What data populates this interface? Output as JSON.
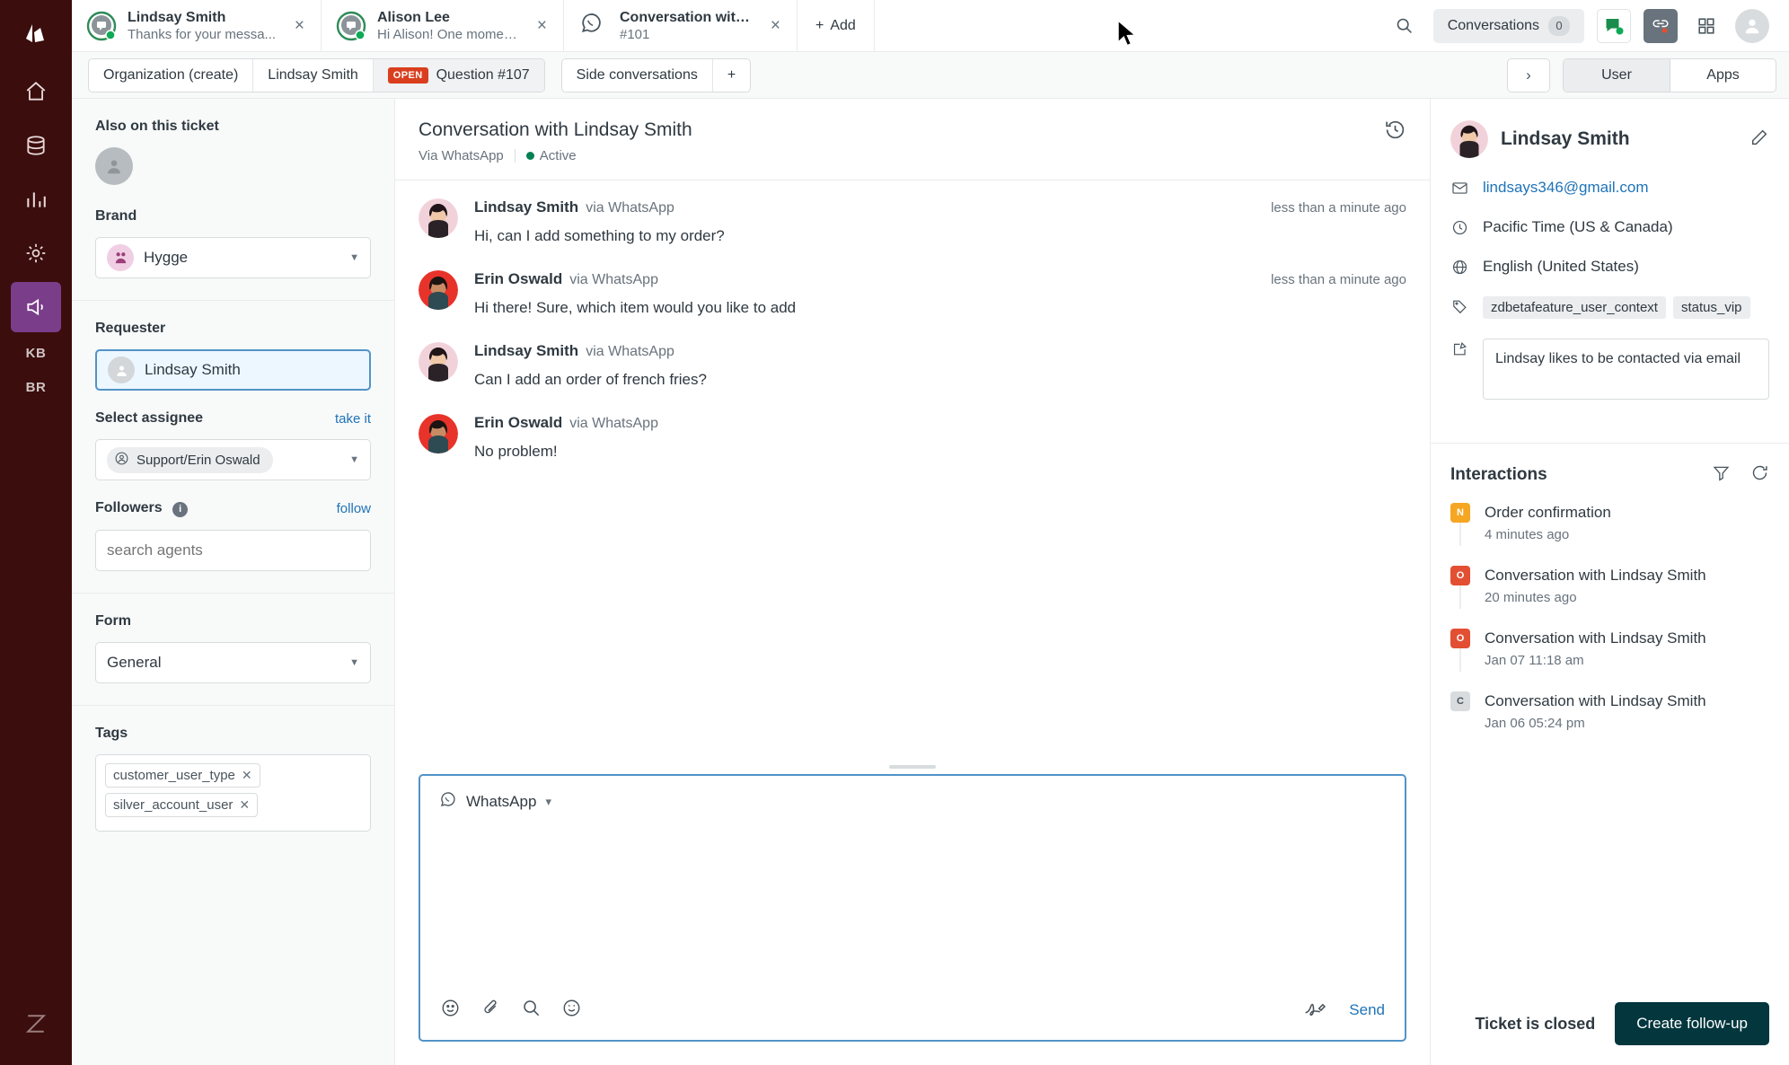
{
  "rail": {
    "items": [
      {
        "name": "zendesk-logo",
        "label": "Zendesk"
      },
      {
        "name": "home",
        "label": "Home"
      },
      {
        "name": "views",
        "label": "Views"
      },
      {
        "name": "reporting",
        "label": "Reporting"
      },
      {
        "name": "admin",
        "label": "Admin"
      },
      {
        "name": "announcements",
        "label": "Announcements"
      }
    ],
    "badges": [
      "KB",
      "BR"
    ],
    "footer_logo": "Z"
  },
  "tabs": [
    {
      "title": "Lindsay Smith",
      "subtitle": "Thanks for your messa...",
      "icon": "messaging-avatar",
      "close": "×"
    },
    {
      "title": "Alison Lee",
      "subtitle": "Hi Alison! One moment ...",
      "icon": "messaging-avatar",
      "close": "×"
    },
    {
      "title": "Conversation with BP",
      "subtitle": "#101",
      "icon": "whatsapp-icon",
      "close": "×"
    }
  ],
  "tabbar": {
    "add_label": "Add",
    "add_plus": "+",
    "conversations_label": "Conversations",
    "conversations_count": "0",
    "icons": [
      "search-icon",
      "chat-status-icon",
      "link-app-icon",
      "apps-grid-icon",
      "user-avatar-icon"
    ]
  },
  "breadcrumb": {
    "items": [
      {
        "label": "Organization (create)",
        "badge": ""
      },
      {
        "label": "Lindsay Smith",
        "badge": ""
      },
      {
        "label": "Question #107",
        "badge": "OPEN",
        "selected": true
      }
    ],
    "side_conversations": "Side conversations",
    "side_add": "+",
    "expand": "›",
    "segments": [
      {
        "label": "User",
        "active": true
      },
      {
        "label": "Apps",
        "active": false
      }
    ]
  },
  "sidebar": {
    "also_on_ticket_label": "Also on this ticket",
    "brand_label": "Brand",
    "brand_value": "Hygge",
    "requester_label": "Requester",
    "requester_value": "Lindsay Smith",
    "assignee_label": "Select assignee",
    "take_it": "take it",
    "assignee_value": "Support/Erin Oswald",
    "followers_label": "Followers",
    "follow_link": "follow",
    "followers_placeholder": "search agents",
    "form_label": "Form",
    "form_value": "General",
    "tags_label": "Tags",
    "tags": [
      "customer_user_type",
      "silver_account_user"
    ]
  },
  "conversation": {
    "title": "Conversation with Lindsay Smith",
    "via": "Via WhatsApp",
    "status": "Active",
    "history_icon": "history-icon",
    "messages": [
      {
        "author": "Lindsay Smith",
        "via": "via WhatsApp",
        "time": "less than a minute ago",
        "text": "Hi, can I add something to my order?",
        "avatar": "customer"
      },
      {
        "author": "Erin Oswald",
        "via": "via WhatsApp",
        "time": "less than a minute ago",
        "text": "Hi there! Sure, which item would you like to add",
        "avatar": "agent"
      },
      {
        "author": "Lindsay Smith",
        "via": "via WhatsApp",
        "time": "",
        "text": "Can I add an order of french fries?",
        "avatar": "customer"
      },
      {
        "author": "Erin Oswald",
        "via": "via WhatsApp",
        "time": "",
        "text": "No problem!",
        "avatar": "agent"
      }
    ]
  },
  "composer": {
    "channel": "WhatsApp",
    "channel_caret": "⌄",
    "value": "",
    "placeholder": "",
    "send_label": "Send",
    "tools": [
      "emoji-icon",
      "attachment-icon",
      "search-icon",
      "smiley-icon",
      "signature-icon"
    ]
  },
  "context": {
    "name": "Lindsay Smith",
    "edit_icon": "pencil-icon",
    "email": "lindsays346@gmail.com",
    "timezone": "Pacific Time (US & Canada)",
    "language": "English (United States)",
    "tags": [
      "zdbetafeature_user_context",
      "status_vip"
    ],
    "note": "Lindsay likes to be contacted via email",
    "interactions_title": "Interactions",
    "interactions_actions": [
      "filter-icon",
      "refresh-icon"
    ],
    "interactions": [
      {
        "mark": "N",
        "mark_color": "#f5a623",
        "title": "Order confirmation",
        "time": "4 minutes ago"
      },
      {
        "mark": "O",
        "mark_color": "#e34f32",
        "title": "Conversation with Lindsay Smith",
        "time": "20 minutes ago"
      },
      {
        "mark": "O",
        "mark_color": "#e34f32",
        "title": "Conversation with Lindsay Smith",
        "time": "Jan 07 11:18 am"
      },
      {
        "mark": "C",
        "mark_color": "#d8dcde",
        "title": "Conversation with Lindsay Smith",
        "time": "Jan 06 05:24 pm"
      }
    ],
    "footer_status": "Ticket is closed",
    "footer_button": "Create follow-up"
  },
  "colors": {
    "rail_bg": "#3b0d0d",
    "accent_link": "#1f73b7",
    "focus_border": "#5293c7",
    "open_badge": "#d93f1f",
    "active_dot": "#038153",
    "primary_button": "#03363d"
  }
}
